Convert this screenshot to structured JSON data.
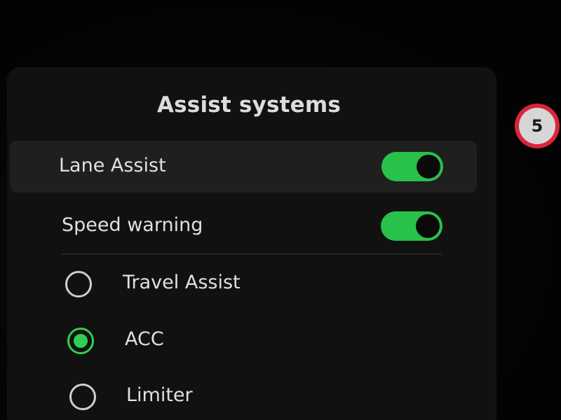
{
  "panel": {
    "title": "Assist systems",
    "toggles": [
      {
        "label": "Lane Assist",
        "state": "on"
      },
      {
        "label": "Speed warning",
        "state": "on"
      }
    ],
    "options": [
      {
        "label": "Travel Assist",
        "selected": false
      },
      {
        "label": "ACC",
        "selected": true
      },
      {
        "label": "Limiter",
        "selected": false
      }
    ]
  },
  "speed_limit_sign": {
    "value": "5"
  },
  "colors": {
    "accent_green": "#28c24a",
    "sign_red": "#d9263a",
    "panel_bg": "#111111"
  }
}
